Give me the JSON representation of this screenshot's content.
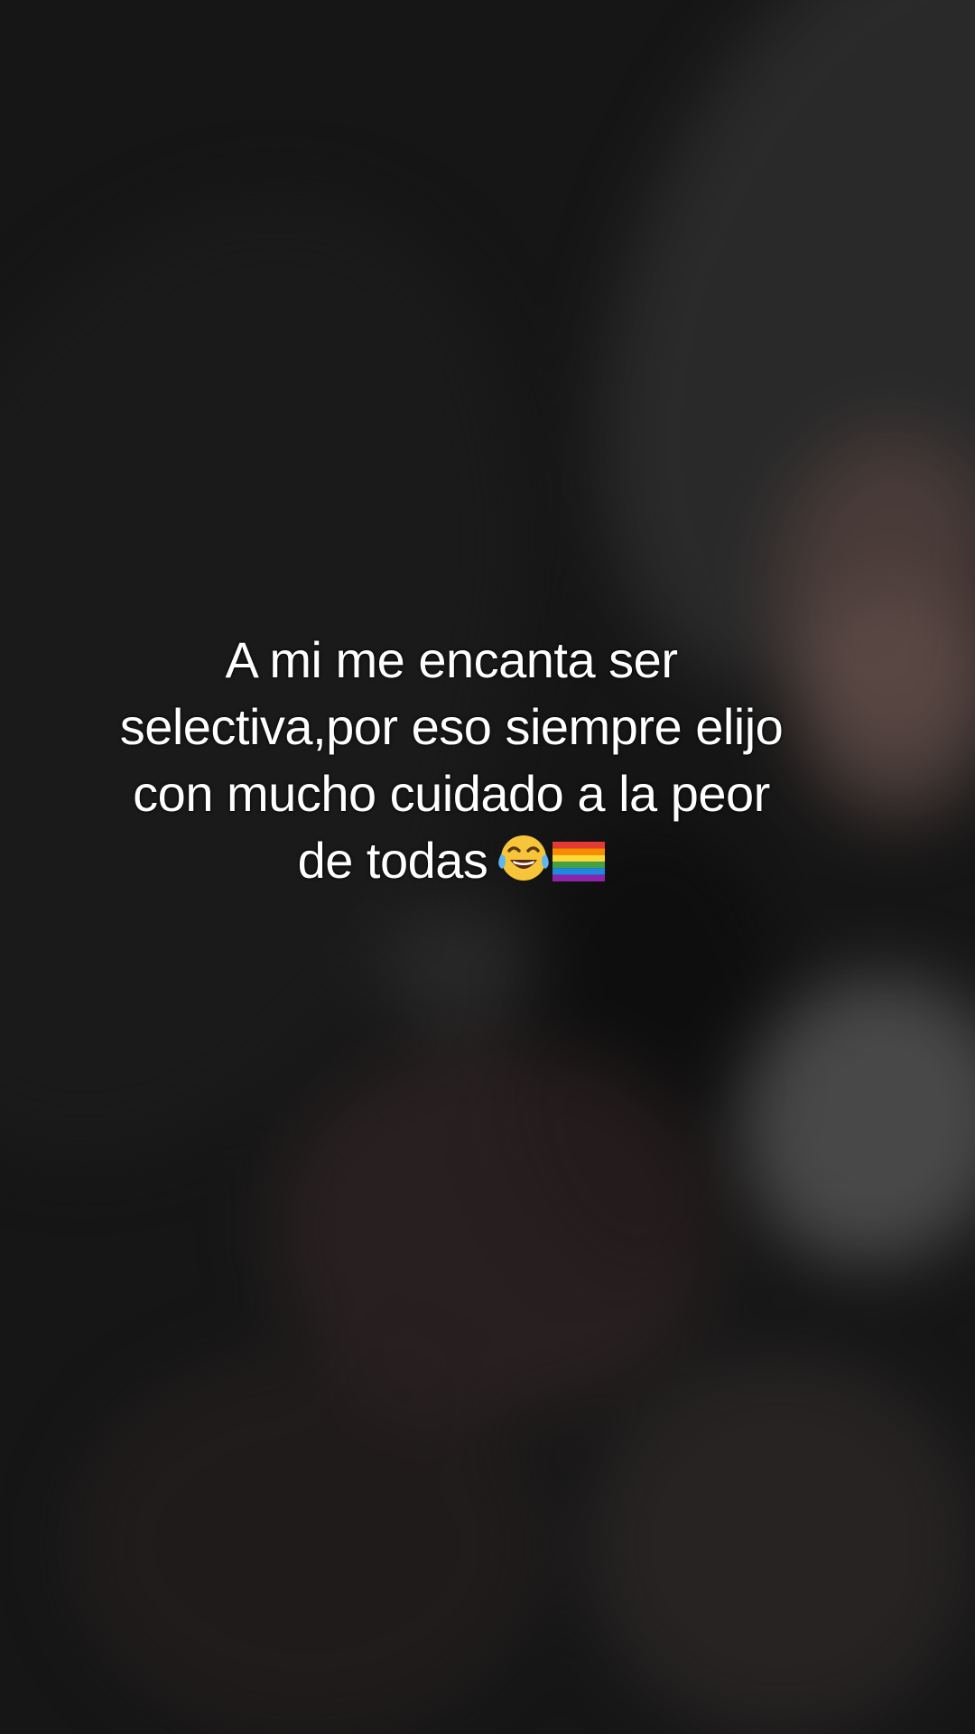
{
  "caption": {
    "lines": [
      "A mi me encanta ser",
      "selectiva,por eso siempre elijo",
      "con mucho cuidado a la peor",
      "de todas"
    ],
    "emojis": [
      "laughing-with-tears-emoji",
      "rainbow-flag-emoji"
    ]
  },
  "colors": {
    "background": "#161616",
    "caption_text": "#ffffff"
  }
}
